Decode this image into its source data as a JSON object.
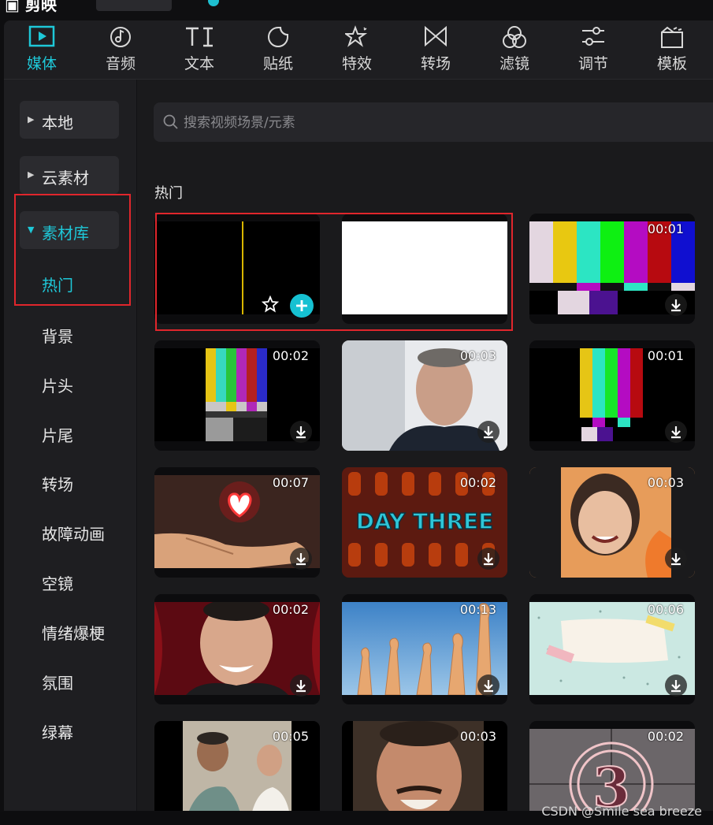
{
  "tabs": [
    {
      "label": "媒体",
      "icon": "media-icon"
    },
    {
      "label": "音频",
      "icon": "audio-icon"
    },
    {
      "label": "文本",
      "icon": "text-icon"
    },
    {
      "label": "贴纸",
      "icon": "sticker-icon"
    },
    {
      "label": "特效",
      "icon": "effects-icon"
    },
    {
      "label": "转场",
      "icon": "transition-icon"
    },
    {
      "label": "滤镜",
      "icon": "filter-icon"
    },
    {
      "label": "调节",
      "icon": "adjust-icon"
    },
    {
      "label": "模板",
      "icon": "template-icon"
    }
  ],
  "sidebar": {
    "local": "本地",
    "cloud": "云素材",
    "library": "素材库",
    "items": [
      "热门",
      "背景",
      "片头",
      "片尾",
      "转场",
      "故障动画",
      "空镜",
      "情绪爆梗",
      "氛围",
      "绿幕"
    ]
  },
  "search": {
    "placeholder": "搜索视频场景/元素"
  },
  "section_title": "热门",
  "cards": [
    {
      "duration": ""
    },
    {
      "duration": ""
    },
    {
      "duration": "00:01"
    },
    {
      "duration": "00:02"
    },
    {
      "duration": "00:03"
    },
    {
      "duration": "00:01"
    },
    {
      "duration": "00:07"
    },
    {
      "duration": "00:02"
    },
    {
      "duration": "00:03"
    },
    {
      "duration": "00:02"
    },
    {
      "duration": "00:13"
    },
    {
      "duration": "00:06"
    },
    {
      "duration": "00:05"
    },
    {
      "duration": "00:03"
    },
    {
      "duration": "00:02"
    }
  ],
  "card_texts": {
    "day_three": "DAY THREE",
    "countdown": "3"
  },
  "watermark": "CSDN @Smile sea breeze",
  "colors": {
    "accent": "#1ec8d8",
    "highlight": "#e0262c"
  }
}
